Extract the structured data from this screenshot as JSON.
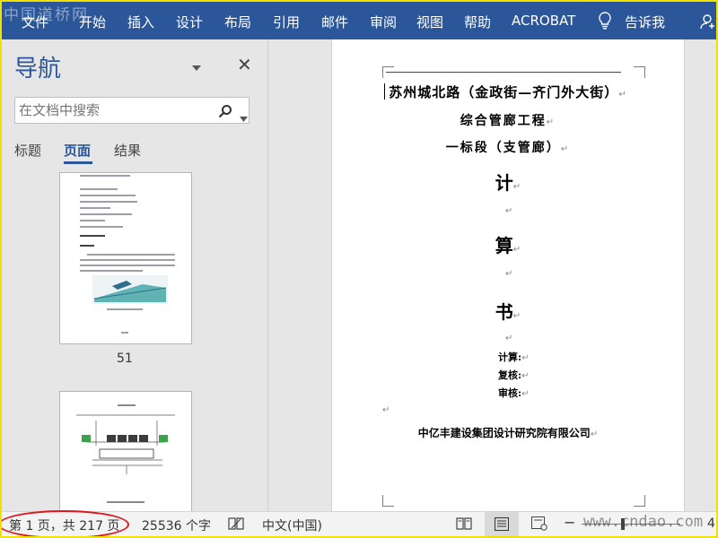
{
  "ribbon": {
    "tabs": [
      "文件",
      "开始",
      "插入",
      "设计",
      "布局",
      "引用",
      "邮件",
      "审阅",
      "视图",
      "帮助",
      "ACROBAT"
    ],
    "tell_me": "告诉我",
    "color": "#2b579a"
  },
  "watermarks": {
    "top": "中国道桥网",
    "bottom": "www.cndao.com"
  },
  "nav": {
    "title": "导航",
    "search_placeholder": "在文档中搜索",
    "tabs": [
      "标题",
      "页面",
      "结果"
    ],
    "active_tab": "页面",
    "thumbnails": [
      {
        "page_number": "51"
      },
      {
        "page_number": ""
      }
    ]
  },
  "document": {
    "title_line1": "苏州城北路（金政街—齐门外大街）",
    "title_line2": "综合管廊工程",
    "title_line3": "一标段（支管廊）",
    "calc_chars": [
      "计",
      "算",
      "书"
    ],
    "signatures": [
      "计算:",
      "复核:",
      "审核:"
    ],
    "company": "中亿丰建设集团设计研究院有限公司",
    "para_mark": "↵"
  },
  "status": {
    "page_info": "第 1 页，共 217 页",
    "word_count": "25536 个字",
    "language": "中文(中国)",
    "zoom_tail": "4"
  },
  "annotation": {
    "highlight_color": "#e0141b"
  }
}
